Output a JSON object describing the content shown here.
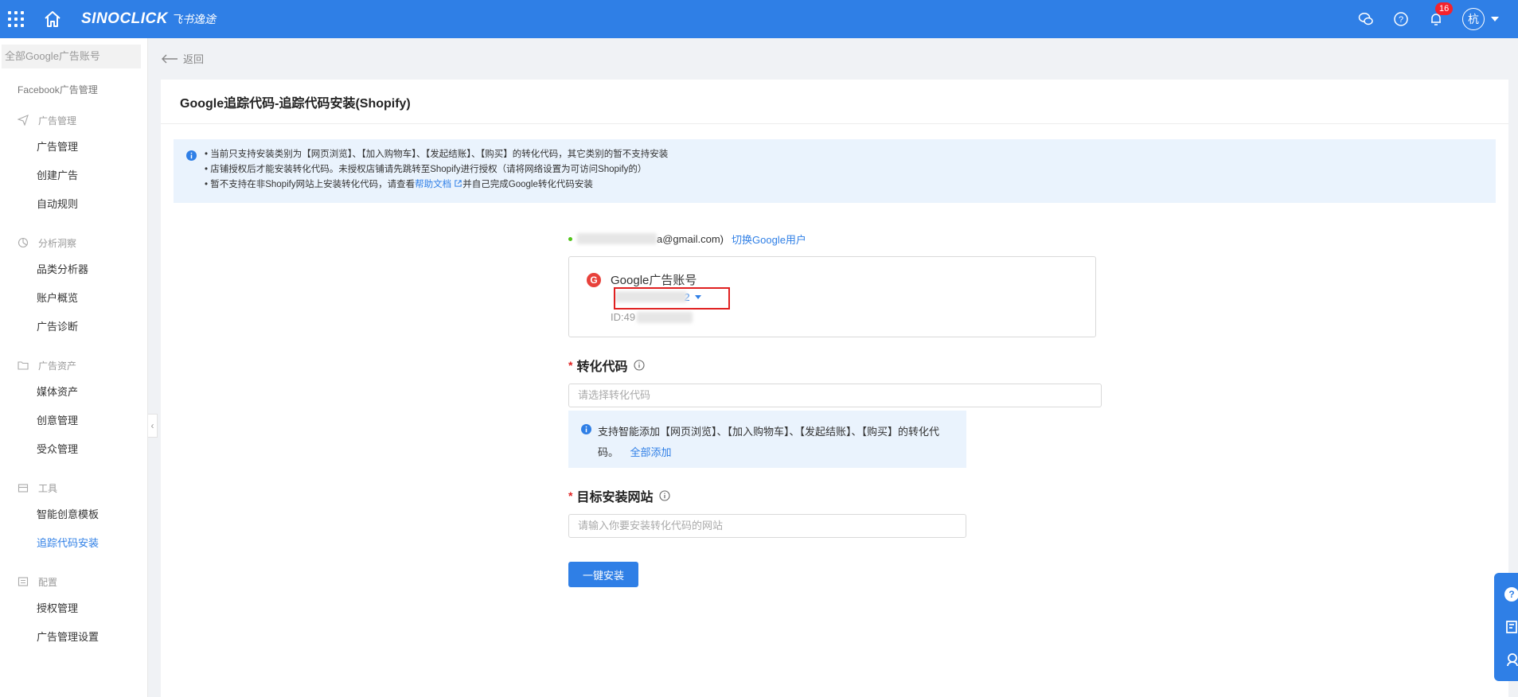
{
  "topbar": {
    "brand": "SINOCLICK",
    "brand_sub": "飞书逸途",
    "notification_count": "16",
    "avatar_text": "杭"
  },
  "sidebar": {
    "account_select_label": "全部Google广告账号",
    "facebook_link": "Facebook广告管理",
    "groups": [
      {
        "label": "广告管理",
        "icon": "paper-plane-icon",
        "items": [
          "广告管理",
          "创建广告",
          "自动规则"
        ]
      },
      {
        "label": "分析洞察",
        "icon": "chart-icon",
        "items": [
          "品类分析器",
          "账户概览",
          "广告诊断"
        ]
      },
      {
        "label": "广告资产",
        "icon": "folder-icon",
        "items": [
          "媒体资产",
          "创意管理",
          "受众管理"
        ]
      },
      {
        "label": "工具",
        "icon": "toolbox-icon",
        "items": [
          "智能创意模板",
          "追踪代码安装"
        ]
      },
      {
        "label": "配置",
        "icon": "config-icon",
        "items": [
          "授权管理",
          "广告管理设置"
        ]
      }
    ],
    "active_item": "追踪代码安装"
  },
  "back_label": "返回",
  "page_title": "Google追踪代码-追踪代码安装(Shopify)",
  "notice": {
    "line1": "• 当前只支持安装类别为【网页浏览】、【加入购物车】、【发起结账】、【购买】的转化代码，其它类别的暂不支持安装",
    "line2": "• 店铺授权后才能安装转化代码。未授权店铺请先跳转至Shopify进行授权（请将网络设置为可访问Shopify的）",
    "line3_pre": "• 暂不支持在非Shopify网站上安装转化代码，请查看",
    "line3_link": "帮助文档",
    "line3_post": "并自己完成Google转化代码安装"
  },
  "user": {
    "email_suffix": "a@gmail.com)",
    "switch_link": "切换Google用户"
  },
  "ad_account": {
    "title": "Google广告账号",
    "selected_suffix": "-2",
    "id_prefix": "ID:49"
  },
  "conversion": {
    "label": "转化代码",
    "placeholder": "请选择转化代码",
    "tip": "支持智能添加【网页浏览】、【加入购物车】、【发起结账】、【购买】的转化代码。",
    "tip_link": "全部添加"
  },
  "target_site": {
    "label": "目标安装网站",
    "placeholder": "请输入你要安装转化代码的网站"
  },
  "install_button": "一键安装",
  "colors": {
    "primary": "#2f7fe6",
    "danger": "#e02020",
    "notice_bg": "#eaf3fd"
  }
}
